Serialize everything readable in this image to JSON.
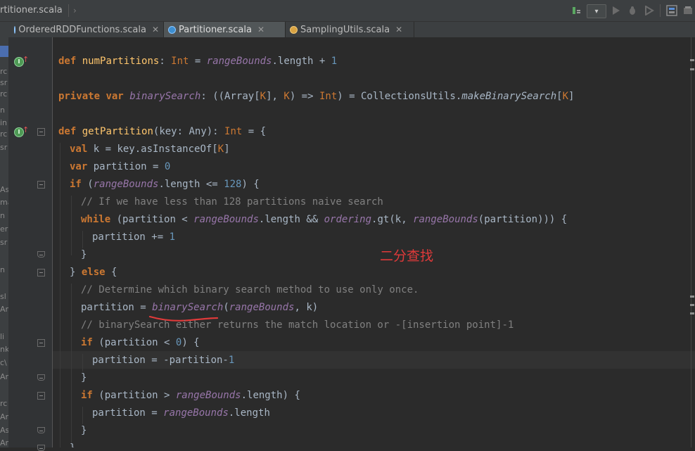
{
  "breadcrumb": {
    "file": "rtitioner.scala"
  },
  "toolbar": {
    "run_config": "▾"
  },
  "tabs": [
    {
      "label": "OrderedRDDFunctions.scala",
      "icon": "scala-class-icon",
      "active": false
    },
    {
      "label": "Partitioner.scala",
      "icon": "scala-class-icon",
      "active": true
    },
    {
      "label": "SamplingUtils.scala",
      "icon": "scala-object-icon",
      "active": false
    }
  ],
  "left_panel": {
    "fragments": [
      "rc",
      "sr",
      "rc",
      "n",
      "in",
      "rc",
      "sr",
      "As",
      "ma",
      "n",
      "er",
      "sr",
      "n",
      "sl",
      "Am",
      "li",
      "nk",
      "c\\",
      "Am",
      "rc",
      "Am",
      "As",
      "Am"
    ]
  },
  "editor": {
    "lines": {
      "l1": {
        "kw": "def",
        "name": "numPartitions",
        "colon": ": ",
        "type": "Int",
        "eq": " = ",
        "field": "rangeBounds",
        "rest": ".length + ",
        "num": "1"
      },
      "l2": {
        "kw1": "private",
        "kw2": "var",
        "field": "binarySearch",
        "sig1": ": ((Array[",
        "k1": "K",
        "sig2": "], ",
        "k2": "K",
        "sig3": ") => ",
        "type": "Int",
        "sig4": ") = CollectionsUtils.",
        "call": "makeBinarySearch",
        "br1": "[",
        "k3": "K",
        "br2": "]"
      },
      "l3": {
        "kw": "def",
        "name": "getPartition",
        "args": "(key: Any): ",
        "type": "Int",
        "rest": " = {"
      },
      "l4": {
        "kw": "val",
        "rest": " k = key.asInstanceOf",
        "br1": "[",
        "k": "K",
        "br2": "]"
      },
      "l5": {
        "kw": "var",
        "rest": " partition = ",
        "num": "0"
      },
      "l6": {
        "kw": "if",
        "open": " (",
        "field": "rangeBounds",
        "rest": ".length <= ",
        "num": "128",
        "close": ") {"
      },
      "l7": {
        "comment": "// If we have less than 128 partitions naive search"
      },
      "l8": {
        "kw": "while",
        "p1": " (partition < ",
        "field1": "rangeBounds",
        "p2": ".length && ",
        "field2": "ordering",
        "p3": ".gt(k, ",
        "field3": "rangeBounds",
        "p4": "(partition))) {"
      },
      "l9": {
        "rest": "partition += ",
        "num": "1"
      },
      "l10": {
        "rest": "}"
      },
      "l11": {
        "pre": "} ",
        "kw": "else",
        "post": " {"
      },
      "l12": {
        "comment": "// Determine which binary search method to use only once."
      },
      "l13": {
        "pre": "partition = ",
        "field1": "binarySearch",
        "p1": "(",
        "field2": "rangeBounds",
        "p2": ", k)"
      },
      "l14": {
        "comment": "// binarySearch either returns the match location or -[insertion point]-1"
      },
      "l15": {
        "kw": "if",
        "pre": " (partition < ",
        "num": "0",
        "post": ") {"
      },
      "l16": {
        "pre": "partition = -partition-",
        "num": "1"
      },
      "l17": {
        "rest": "}"
      },
      "l18": {
        "kw": "if",
        "pre": " (partition > ",
        "field": "rangeBounds",
        "post": ".length) {"
      },
      "l19": {
        "pre": "partition = ",
        "field": "rangeBounds",
        "post": ".length"
      },
      "l20": {
        "rest": "}"
      },
      "l21": {
        "rest": "}"
      }
    },
    "annotation": "二分查找",
    "annotation_color": "#e03a3a"
  },
  "colors": {
    "keyword": "#cc7832",
    "field": "#9876aa",
    "number": "#6897bb",
    "comment": "#808080",
    "text": "#a9b7c6",
    "background": "#2b2b2b"
  }
}
